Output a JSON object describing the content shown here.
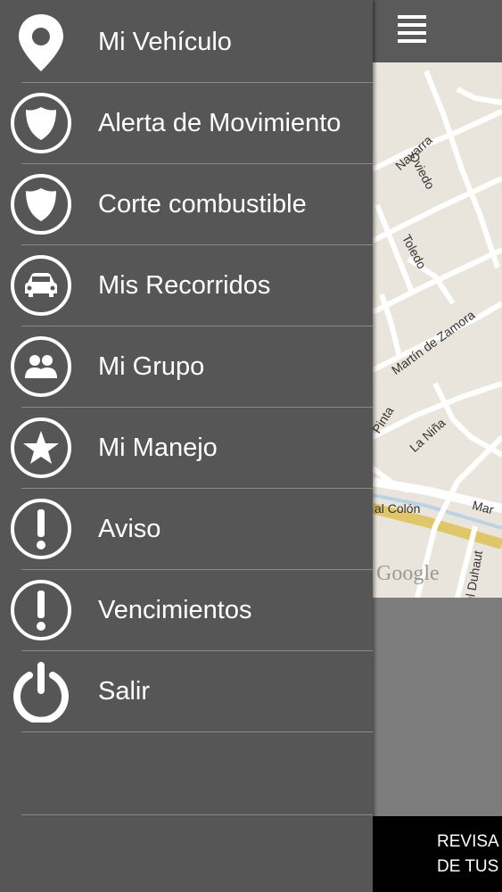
{
  "menu": {
    "items": [
      {
        "label": "Mi Vehículo",
        "icon": "location-pin-icon"
      },
      {
        "label": "Alerta de Movimiento",
        "icon": "shield-icon"
      },
      {
        "label": "Corte combustible",
        "icon": "shield-icon"
      },
      {
        "label": "Mis Recorridos",
        "icon": "car-icon"
      },
      {
        "label": "Mi Grupo",
        "icon": "group-icon"
      },
      {
        "label": "Mi Manejo",
        "icon": "star-icon"
      },
      {
        "label": "Aviso",
        "icon": "exclamation-icon"
      },
      {
        "label": "Vencimientos",
        "icon": "exclamation-icon"
      },
      {
        "label": "Salir",
        "icon": "power-icon"
      }
    ]
  },
  "map": {
    "streets": [
      "Navarra",
      "Oviedo",
      "Toledo",
      "Martín de Zamora",
      "Pinta",
      "La Niña",
      "al Colón",
      "Mar",
      "el Duhaut"
    ],
    "attribution": "Google"
  },
  "banner": {
    "line1": "REVISA",
    "line2": "DE TUS"
  },
  "colors": {
    "drawer": "#575656",
    "divider": "#8a8a8a",
    "text": "#ffffff",
    "map_bg": "#e9e5dc",
    "highway": "#f0d46a"
  }
}
